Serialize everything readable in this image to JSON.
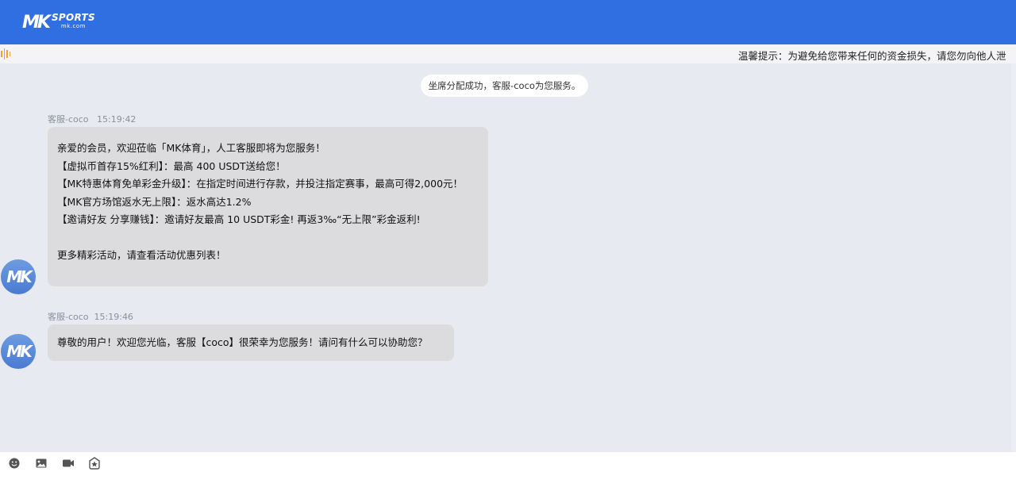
{
  "header": {
    "logo_main": "MK",
    "logo_brand": "SPORTS",
    "logo_domain": "mk.com"
  },
  "notice": {
    "icon": "sound-wave-icon",
    "text": "温馨提示：为避免给您带来任何的资金损失，请您勿向他人泄"
  },
  "chat": {
    "system_message": "坐席分配成功，客服-coco为您服务。",
    "messages": [
      {
        "sender": "客服-coco",
        "time": "15:19:42",
        "avatar_text": "MK",
        "lines": [
          "亲爱的会员，欢迎莅临「MK体育」，人工客服即将为您服务！",
          "【虚拟币首存15%红利】：最高 400 USDT送给您！",
          "【MK特惠体育免单彩金升级】：在指定时间进行存款，并投注指定赛事，最高可得2,000元！",
          "【MK官方场馆返水无上限】：返水高达1.2%",
          "【邀请好友 分享赚钱】：邀请好友最高 10 USDT彩金! 再返3‰“无上限”彩金返利!",
          "",
          "更多精彩活动，请查看活动优惠列表！"
        ]
      },
      {
        "sender": "客服-coco",
        "time": "15:19:46",
        "avatar_text": "MK",
        "text": "尊敬的用户！欢迎您光临，客服【coco】很荣幸为您服务！请问有什么可以协助您？"
      }
    ]
  },
  "toolbar": {
    "icons": [
      "emoji-icon",
      "image-icon",
      "video-icon",
      "evaluate-icon"
    ]
  },
  "colors": {
    "header_bg": "#2f6fe2",
    "chat_bg": "#e8eaf1",
    "bubble_bg": "#dcdcdf",
    "notice_accent": "#f0a030"
  }
}
